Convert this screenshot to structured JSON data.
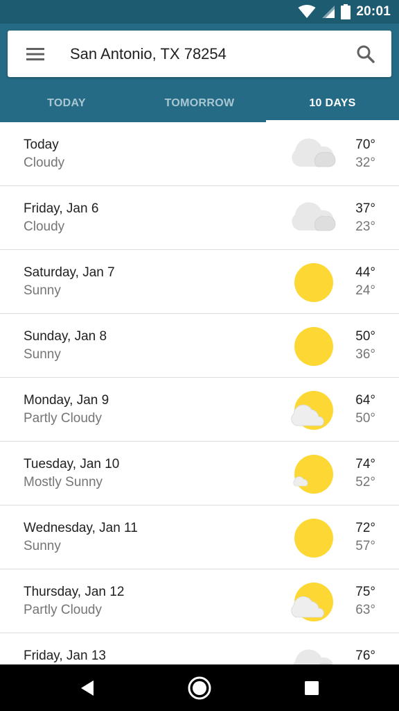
{
  "status_bar": {
    "time": "20:01",
    "icons": [
      "wifi-icon",
      "cell-signal-icon",
      "battery-icon"
    ]
  },
  "search": {
    "location": "San Antonio, TX 78254",
    "menu_icon": "menu-icon",
    "search_icon": "search-icon"
  },
  "tabs": [
    {
      "label": "TODAY",
      "active": false
    },
    {
      "label": "TOMORROW",
      "active": false
    },
    {
      "label": "10 DAYS",
      "active": true
    }
  ],
  "forecast": [
    {
      "day": "Today",
      "condition": "Cloudy",
      "icon": "cloudy-icon",
      "high": "70°",
      "low": "32°"
    },
    {
      "day": "Friday, Jan 6",
      "condition": "Cloudy",
      "icon": "cloudy-icon",
      "high": "37°",
      "low": "23°"
    },
    {
      "day": "Saturday, Jan 7",
      "condition": "Sunny",
      "icon": "sunny-icon",
      "high": "44°",
      "low": "24°"
    },
    {
      "day": "Sunday, Jan 8",
      "condition": "Sunny",
      "icon": "sunny-icon",
      "high": "50°",
      "low": "36°"
    },
    {
      "day": "Monday, Jan 9",
      "condition": "Partly Cloudy",
      "icon": "partly-cloudy-icon",
      "high": "64°",
      "low": "50°"
    },
    {
      "day": "Tuesday, Jan 10",
      "condition": "Mostly Sunny",
      "icon": "mostly-sunny-icon",
      "high": "74°",
      "low": "52°"
    },
    {
      "day": "Wednesday, Jan 11",
      "condition": "Sunny",
      "icon": "sunny-icon",
      "high": "72°",
      "low": "57°"
    },
    {
      "day": "Thursday, Jan 12",
      "condition": "Partly Cloudy",
      "icon": "partly-cloudy-icon",
      "high": "75°",
      "low": "63°"
    },
    {
      "day": "Friday, Jan 13",
      "condition": "",
      "icon": "cloudy-icon",
      "high": "76°",
      "low": ""
    }
  ],
  "colors": {
    "status_bar": "#1d5b70",
    "header": "#266b86",
    "sun": "#fdd835",
    "cloud": "#e6e6e6"
  },
  "nav_bar": {
    "icons": [
      "back-icon",
      "home-icon",
      "recents-icon"
    ]
  }
}
